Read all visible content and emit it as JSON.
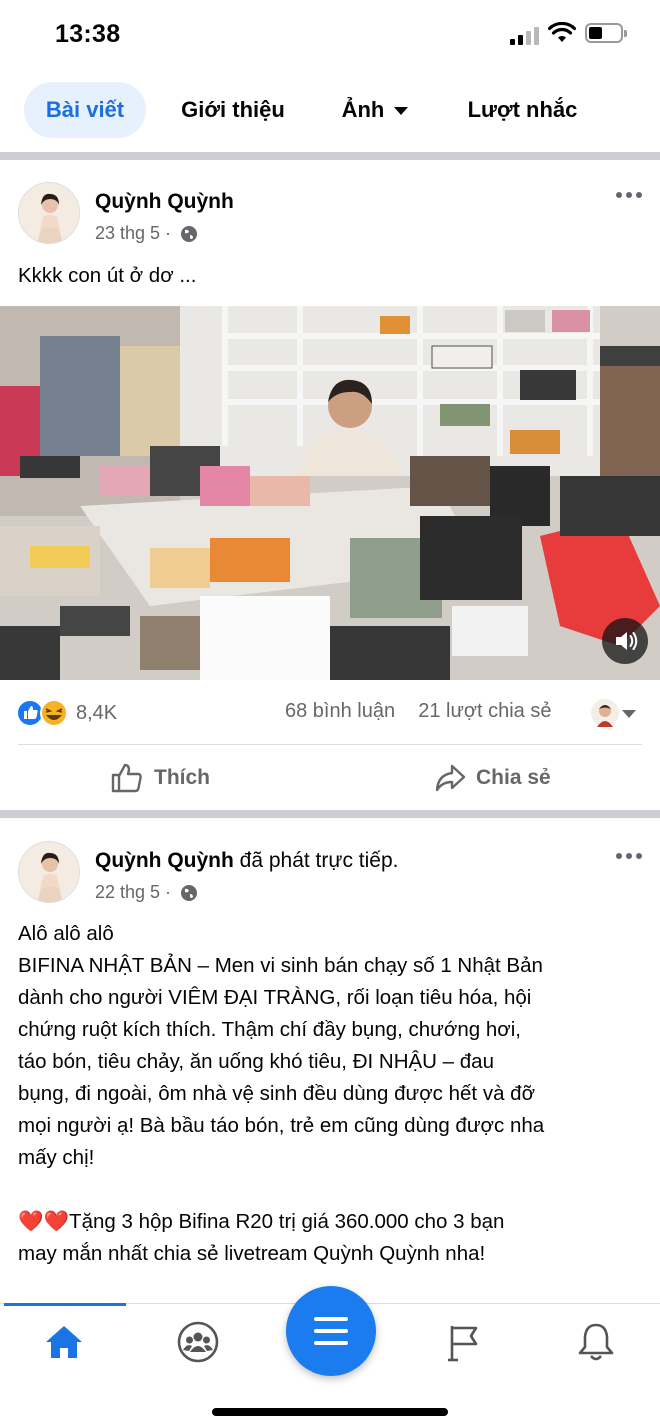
{
  "status_bar": {
    "time": "13:38"
  },
  "tabs": [
    {
      "label": "Bài viết",
      "active": true
    },
    {
      "label": "Giới thiệu",
      "active": false
    },
    {
      "label": "Ảnh",
      "active": false
    },
    {
      "label": "Lượt nhắc",
      "active": false
    }
  ],
  "post1": {
    "author": "Quỳnh Quỳnh",
    "date": "23 thg 5 ·",
    "text": "Kkkk con út ở dơ ...",
    "reactions_count": "8,4K",
    "comments": "68 bình luận",
    "shares": "21 lượt chia sẻ",
    "like_label": "Thích",
    "share_label": "Chia sẻ"
  },
  "post2": {
    "author": "Quỳnh Quỳnh",
    "action": " đã phát trực tiếp.",
    "date": "22 thg 5 ·",
    "lines": [
      "Alô alô alô",
      "BIFINA NHẬT BẢN – Men vi sinh bán chạy số 1 Nhật Bản",
      "dành cho người VIÊM ĐẠI TRÀNG, rối loạn tiêu hóa, hội",
      "chứng ruột kích thích. Thậm chí đầy bụng, chướng hơi,",
      "táo bón, tiêu chảy, ăn uống khó tiêu, ĐI NHẬU – đau",
      "bụng, đi ngoài, ôm nhà vệ sinh đều dùng được hết và đỡ",
      "mọi người ạ! Bà bầu táo bón, trẻ em cũng dùng được nha",
      "mấy chị!",
      "",
      "❤️❤️Tặng 3 hộp Bifina R20 trị giá 360.000 cho 3 bạn",
      "may mắn nhất chia sẻ livetream Quỳnh Quỳnh nha!"
    ]
  },
  "colors": {
    "accent": "#1b74e4",
    "tab_active_bg": "#e7f0fd",
    "secondary_text": "#65676b"
  },
  "bottom_nav": [
    "home-icon",
    "groups-icon",
    "menu-icon",
    "pages-flag-icon",
    "notifications-bell-icon"
  ]
}
